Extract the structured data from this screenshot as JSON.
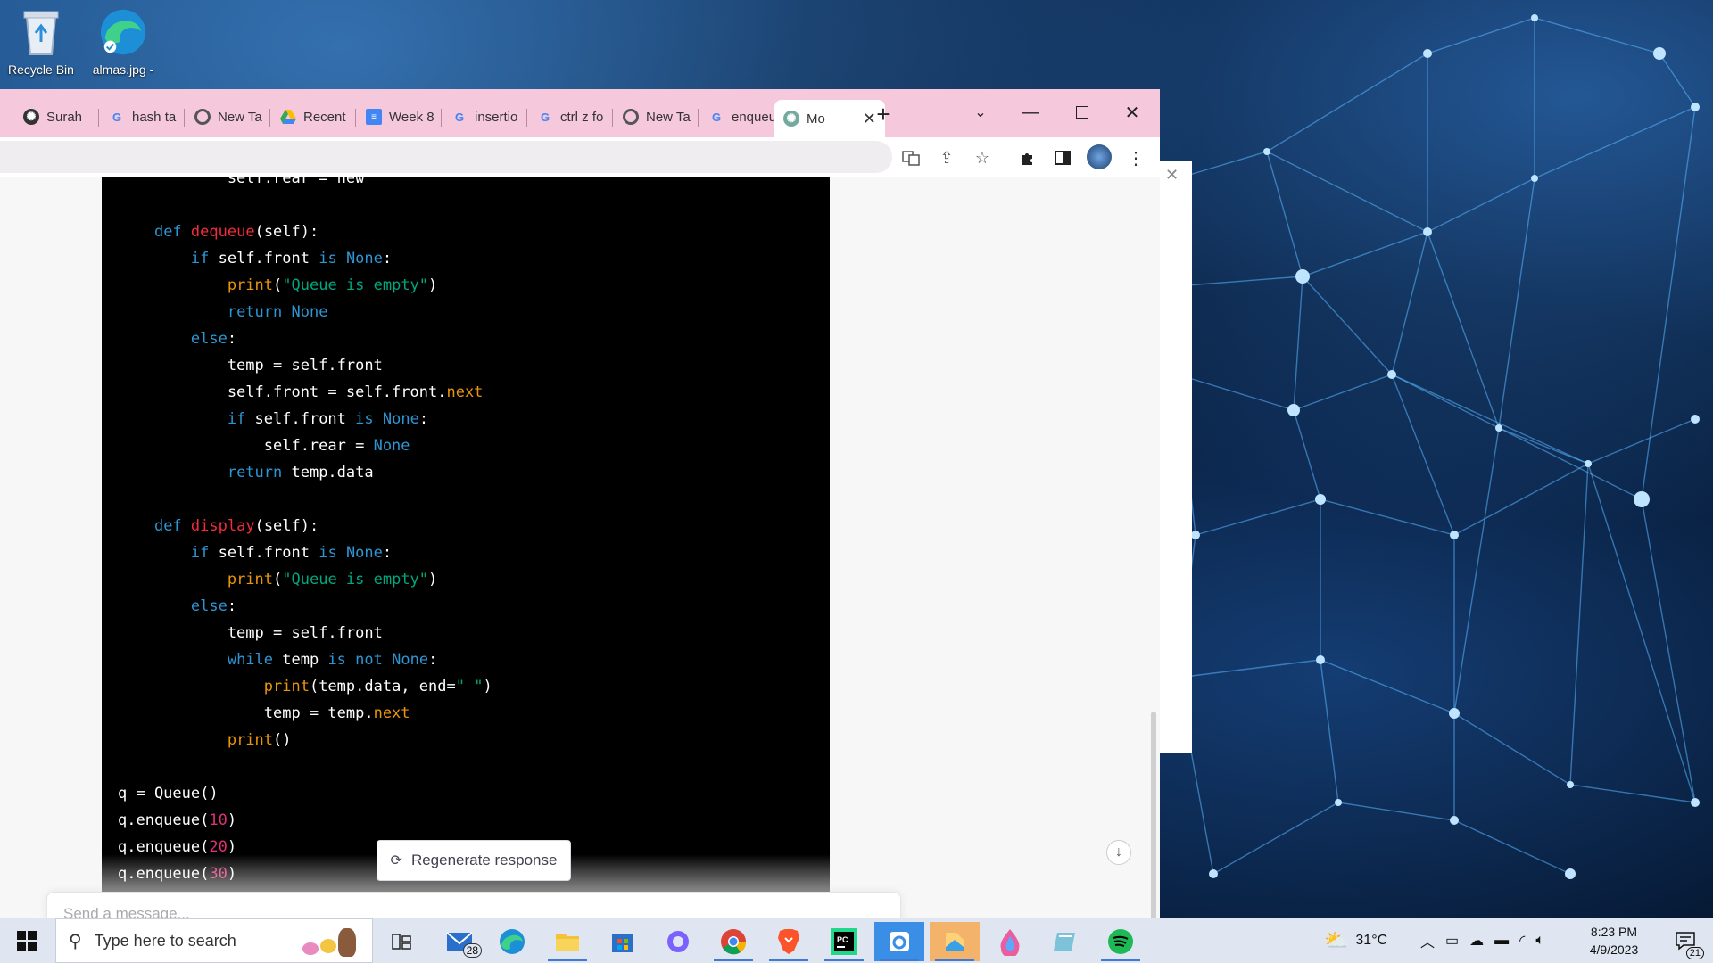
{
  "desktop": {
    "icons": [
      {
        "label": "Recycle Bin",
        "icon": "recycle-bin-icon"
      },
      {
        "label": "almas.jpg - Shortcut",
        "icon": "edge-shortcut-icon"
      }
    ]
  },
  "browser": {
    "tabs": [
      {
        "label": "Surah",
        "icon": "openai-icon"
      },
      {
        "label": "hash ta",
        "icon": "google-icon"
      },
      {
        "label": "New Ta",
        "icon": "chrome-icon"
      },
      {
        "label": "Recent",
        "icon": "google-drive-icon"
      },
      {
        "label": "Week 8",
        "icon": "google-docs-icon"
      },
      {
        "label": "insertio",
        "icon": "google-icon"
      },
      {
        "label": "ctrl z fo",
        "icon": "google-icon"
      },
      {
        "label": "New Ta",
        "icon": "chrome-icon"
      },
      {
        "label": "enqueu",
        "icon": "google-icon"
      },
      {
        "label": "Mo",
        "icon": "openai-icon",
        "active": true
      }
    ],
    "tabstrip_color": "#f6c8dc"
  },
  "chat": {
    "code_lines": [
      "            self.rear = new",
      "",
      "    def dequeue(self):",
      "        if self.front is None:",
      "            print(\"Queue is empty\")",
      "            return None",
      "        else:",
      "            temp = self.front",
      "            self.front = self.front.next",
      "            if self.front is None:",
      "                self.rear = None",
      "            return temp.data",
      "",
      "    def display(self):",
      "        if self.front is None:",
      "            print(\"Queue is empty\")",
      "        else:",
      "            temp = self.front",
      "            while temp is not None:",
      "                print(temp.data, end=\" \")",
      "                temp = temp.next",
      "            print()",
      "",
      "q = Queue()",
      "q.enqueue(10)",
      "q.enqueue(20)",
      "q.enqueue(30)"
    ],
    "regenerate_label": "Regenerate response",
    "input_placeholder": "Send a message..."
  },
  "taskbar": {
    "search_placeholder": "Type here to search",
    "mail_badge": "28",
    "weather": "31°C",
    "time": "8:23 PM",
    "date": "4/9/2023",
    "notification_count": "21",
    "apps": [
      "task-view-icon",
      "mail-icon",
      "edge-icon",
      "file-explorer-icon",
      "microsoft-store-icon",
      "office-icon",
      "chrome-icon",
      "brave-icon",
      "pycharm-icon",
      "app-icon",
      "files-icon",
      "paint-icon",
      "notepad-icon",
      "spotify-icon"
    ]
  }
}
